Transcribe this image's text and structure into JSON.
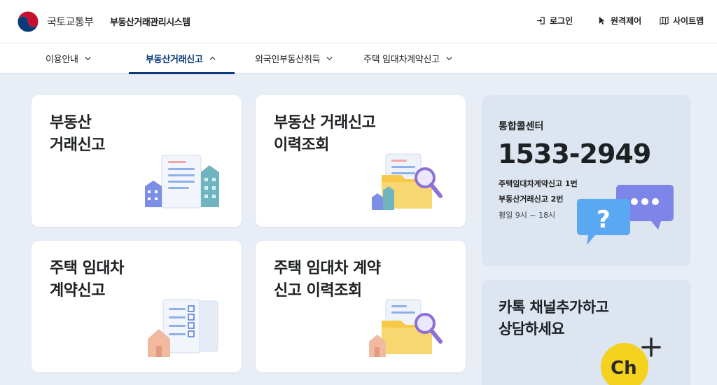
{
  "header": {
    "ministry": "국토교통부",
    "system_name": "부동산거래관리시스템",
    "utilities": {
      "login": "로그인",
      "remote": "원격제어",
      "sitemap": "사이트맵"
    }
  },
  "nav": {
    "items": [
      {
        "label": "이용안내"
      },
      {
        "label": "부동산거래신고"
      },
      {
        "label": "외국인부동산취득"
      },
      {
        "label": "주택 임대차계약신고"
      }
    ]
  },
  "cards": [
    {
      "title": "부동산\n거래신고"
    },
    {
      "title": "부동산 거래신고\n이력조회"
    },
    {
      "title": "주택 임대차\n계약신고"
    },
    {
      "title": "주택 임대차 계약\n신고 이력조회"
    }
  ],
  "call_center": {
    "label": "통합콜센터",
    "number": "1533-2949",
    "line1": "주택임대차계약신고 1번",
    "line2": "부동산거래신고 2번",
    "hours": "평일 9시 ~ 18시",
    "bubble_mark": "?"
  },
  "kakao": {
    "title": "카톡 채널추가하고\n상담하세요",
    "badge": "Ch"
  },
  "colors": {
    "brand_navy": "#0b3a7a",
    "background": "#e9eef6",
    "panel": "#dde5f1"
  }
}
